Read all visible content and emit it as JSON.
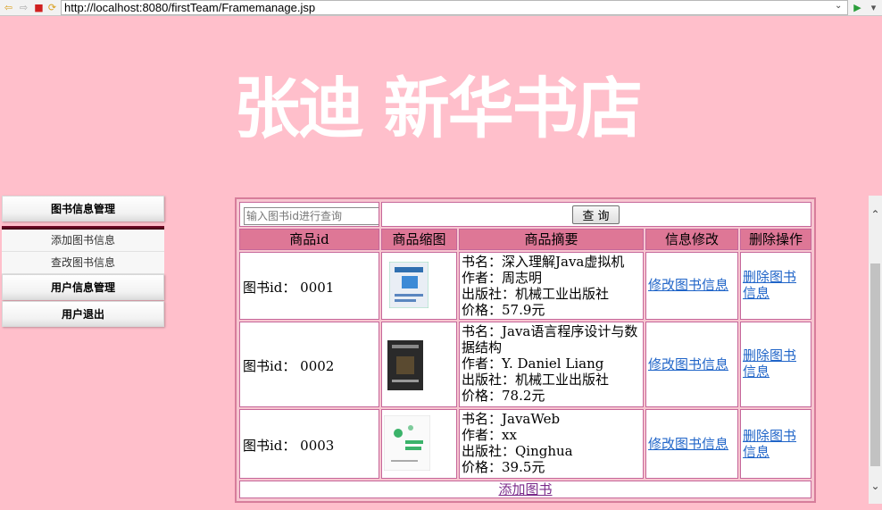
{
  "browser": {
    "url": "http://localhost:8080/firstTeam/Framemanage.jsp"
  },
  "banner": {
    "title": "张迪 新华书店"
  },
  "nav": {
    "book_manage": "图书信息管理",
    "add_book": "添加图书信息",
    "query_book": "查改图书信息",
    "user_manage": "用户信息管理",
    "logout": "用户退出"
  },
  "search": {
    "placeholder": "输入图书id进行查询",
    "button": "查 询"
  },
  "table": {
    "headers": [
      "商品id",
      "商品缩图",
      "商品摘要",
      "信息修改",
      "删除操作"
    ],
    "rows": [
      {
        "id": "图书id：  0001",
        "summary": [
          "书名：深入理解Java虚拟机",
          "作者：周志明",
          "出版社：机械工业出版社",
          "价格：57.9元"
        ],
        "edit": "修改图书信息",
        "delete": "删除图书信息",
        "thumb_color": "#2f6fb0"
      },
      {
        "id": "图书id：  0002",
        "summary": [
          "书名：Java语言程序设计与数据结构",
          "作者：Y. Daniel Liang",
          "出版社：机械工业出版社",
          "价格：78.2元"
        ],
        "edit": "修改图书信息",
        "delete": "删除图书信息",
        "thumb_color": "#2a2a2a"
      },
      {
        "id": "图书id：  0003",
        "summary": [
          "书名：JavaWeb",
          "作者：xx",
          "出版社：Qinghua",
          "价格：39.5元"
        ],
        "edit": "修改图书信息",
        "delete": "删除图书信息",
        "thumb_color": "#3bb36a"
      }
    ],
    "add_link": "添加图书"
  },
  "colors": {
    "page_bg": "#ffbfcb",
    "header_bg": "#de7796",
    "link": "#1f64c8"
  }
}
